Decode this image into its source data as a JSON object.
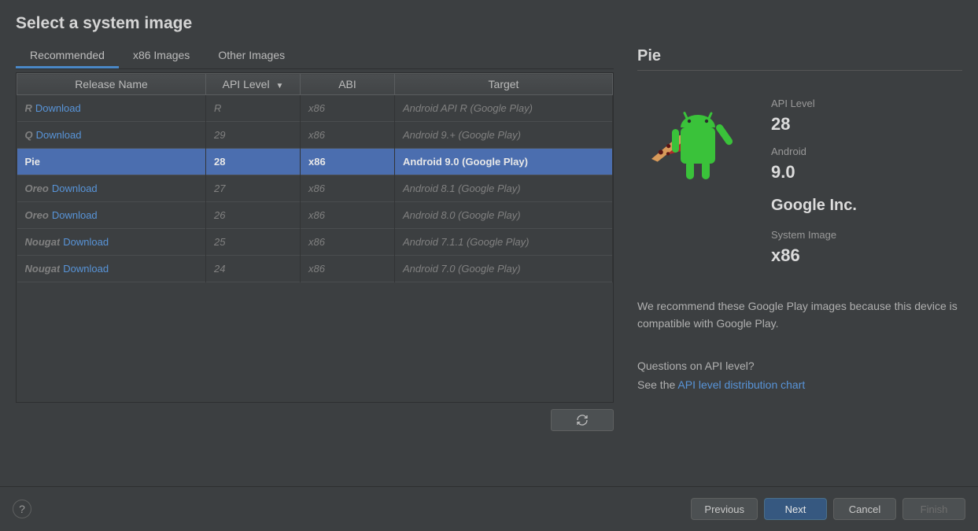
{
  "title": "Select a system image",
  "tabs": [
    {
      "label": "Recommended",
      "active": true
    },
    {
      "label": "x86 Images",
      "active": false
    },
    {
      "label": "Other Images",
      "active": false
    }
  ],
  "columns": {
    "release": "Release Name",
    "api": "API Level",
    "abi": "ABI",
    "target": "Target"
  },
  "download_label": "Download",
  "rows": [
    {
      "name": "R",
      "api": "R",
      "abi": "x86",
      "target": "Android API R (Google Play)",
      "download": true,
      "selected": false
    },
    {
      "name": "Q",
      "api": "29",
      "abi": "x86",
      "target": "Android 9.+ (Google Play)",
      "download": true,
      "selected": false
    },
    {
      "name": "Pie",
      "api": "28",
      "abi": "x86",
      "target": "Android 9.0 (Google Play)",
      "download": false,
      "selected": true
    },
    {
      "name": "Oreo",
      "api": "27",
      "abi": "x86",
      "target": "Android 8.1 (Google Play)",
      "download": true,
      "selected": false
    },
    {
      "name": "Oreo",
      "api": "26",
      "abi": "x86",
      "target": "Android 8.0 (Google Play)",
      "download": true,
      "selected": false
    },
    {
      "name": "Nougat",
      "api": "25",
      "abi": "x86",
      "target": "Android 7.1.1 (Google Play)",
      "download": true,
      "selected": false
    },
    {
      "name": "Nougat",
      "api": "24",
      "abi": "x86",
      "target": "Android 7.0 (Google Play)",
      "download": true,
      "selected": false
    }
  ],
  "detail": {
    "title": "Pie",
    "api_label": "API Level",
    "api_value": "28",
    "android_label": "Android",
    "android_value": "9.0",
    "publisher": "Google Inc.",
    "sysimg_label": "System Image",
    "sysimg_value": "x86",
    "recommend": "We recommend these Google Play images because this device is compatible with Google Play.",
    "question": "Questions on API level?",
    "see_prefix": "See the ",
    "see_link": "API level distribution chart"
  },
  "buttons": {
    "previous": "Previous",
    "next": "Next",
    "cancel": "Cancel",
    "finish": "Finish"
  }
}
